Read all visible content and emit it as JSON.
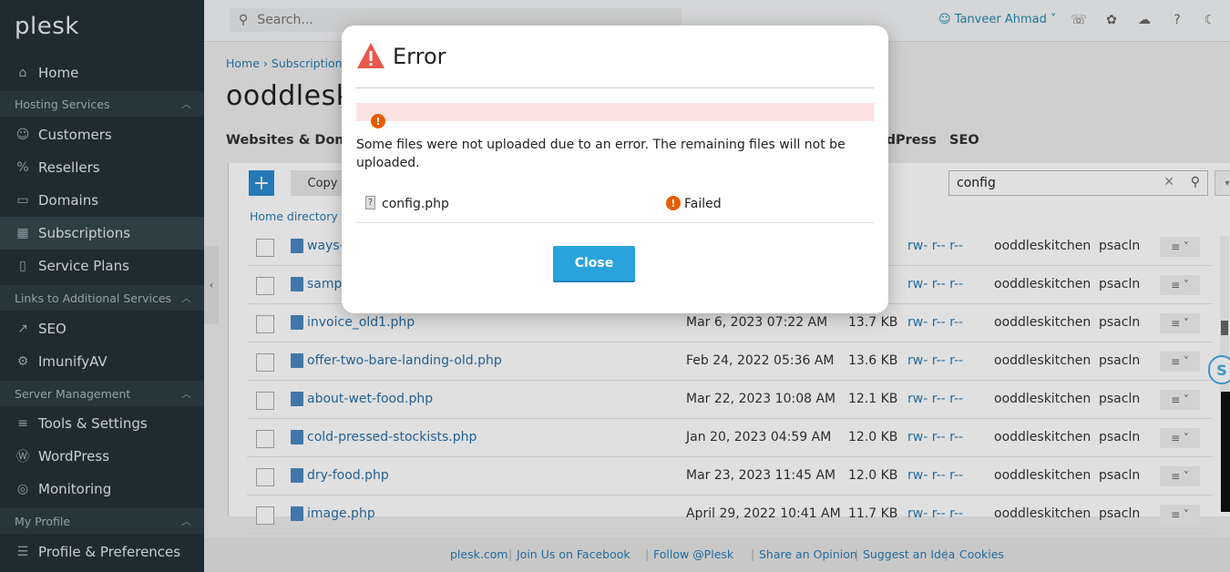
{
  "logo": "plesk",
  "sidebar": {
    "items": [
      {
        "label": "Home",
        "icon": "home-icon"
      },
      {
        "section": "Hosting Services"
      },
      {
        "label": "Customers",
        "icon": "user-icon"
      },
      {
        "label": "Resellers",
        "icon": "percent-icon"
      },
      {
        "label": "Domains",
        "icon": "monitor-icon"
      },
      {
        "label": "Subscriptions",
        "icon": "grid-icon",
        "active": true
      },
      {
        "label": "Service Plans",
        "icon": "book-icon"
      },
      {
        "section": "Links to Additional Services"
      },
      {
        "label": "SEO",
        "icon": "chart-icon"
      },
      {
        "label": "ImunifyAV",
        "icon": "gear-icon"
      },
      {
        "section": "Server Management"
      },
      {
        "label": "Tools & Settings",
        "icon": "sliders-icon"
      },
      {
        "label": "WordPress",
        "icon": "wordpress-icon"
      },
      {
        "label": "Monitoring",
        "icon": "monitoring-icon"
      },
      {
        "section": "My Profile"
      },
      {
        "label": "Profile & Preferences",
        "icon": "profile-icon"
      }
    ]
  },
  "topbar": {
    "search_placeholder": "Search...",
    "user": "Tanveer Ahmad"
  },
  "main": {
    "breadcrumb": [
      "Home",
      "Subscriptions"
    ],
    "title": "ooddlesk",
    "tabs": [
      "Websites & Domains",
      "WordPress",
      "SEO"
    ],
    "toolbar": {
      "copy_label": "Copy",
      "filter_value": "config"
    },
    "dir_breadcrumb": "Home directory",
    "rows": [
      {
        "name": "ways-",
        "date": "",
        "size": "",
        "perms": "rw- r-- r--",
        "owner": "ooddleskitchen",
        "group": "psacln"
      },
      {
        "name": "sampl",
        "date": "",
        "size": "",
        "perms": "rw- r-- r--",
        "owner": "ooddleskitchen",
        "group": "psacln"
      },
      {
        "name": "invoice_old1.php",
        "date": "Mar 6, 2023 07:22 AM",
        "size": "13.7 KB",
        "perms": "rw- r-- r--",
        "owner": "ooddleskitchen",
        "group": "psacln"
      },
      {
        "name": "offer-two-bare-landing-old.php",
        "date": "Feb 24, 2022 05:36 AM",
        "size": "13.6 KB",
        "perms": "rw- r-- r--",
        "owner": "ooddleskitchen",
        "group": "psacln"
      },
      {
        "name": "about-wet-food.php",
        "date": "Mar 22, 2023 10:08 AM",
        "size": "12.1 KB",
        "perms": "rw- r-- r--",
        "owner": "ooddleskitchen",
        "group": "psacln"
      },
      {
        "name": "cold-pressed-stockists.php",
        "date": "Jan 20, 2023 04:59 AM",
        "size": "12.0 KB",
        "perms": "rw- r-- r--",
        "owner": "ooddleskitchen",
        "group": "psacln"
      },
      {
        "name": "dry-food.php",
        "date": "Mar 23, 2023 11:45 AM",
        "size": "12.0 KB",
        "perms": "rw- r-- r--",
        "owner": "ooddleskitchen",
        "group": "psacln"
      },
      {
        "name": "image.php",
        "date": "April 29, 2022 10:41 AM",
        "size": "11.7 KB",
        "perms": "rw- r-- r--",
        "owner": "ooddleskitchen",
        "group": "psacln"
      }
    ]
  },
  "footer": {
    "links": [
      "plesk.com",
      "Join Us on Facebook",
      "Follow @Plesk",
      "Share an Opinion",
      "Suggest an Idea",
      "Cookies"
    ]
  },
  "modal": {
    "title": "Error",
    "message": "Some files were not uploaded due to an error. The remaining files will not be uploaded.",
    "file": "config.php",
    "status": "Failed",
    "close_label": "Close"
  },
  "widget_letter": "S",
  "colors": {
    "sidebar": "#243239",
    "accent": "#29a3db",
    "error": "#e65c00",
    "link": "#2a7ab0"
  }
}
